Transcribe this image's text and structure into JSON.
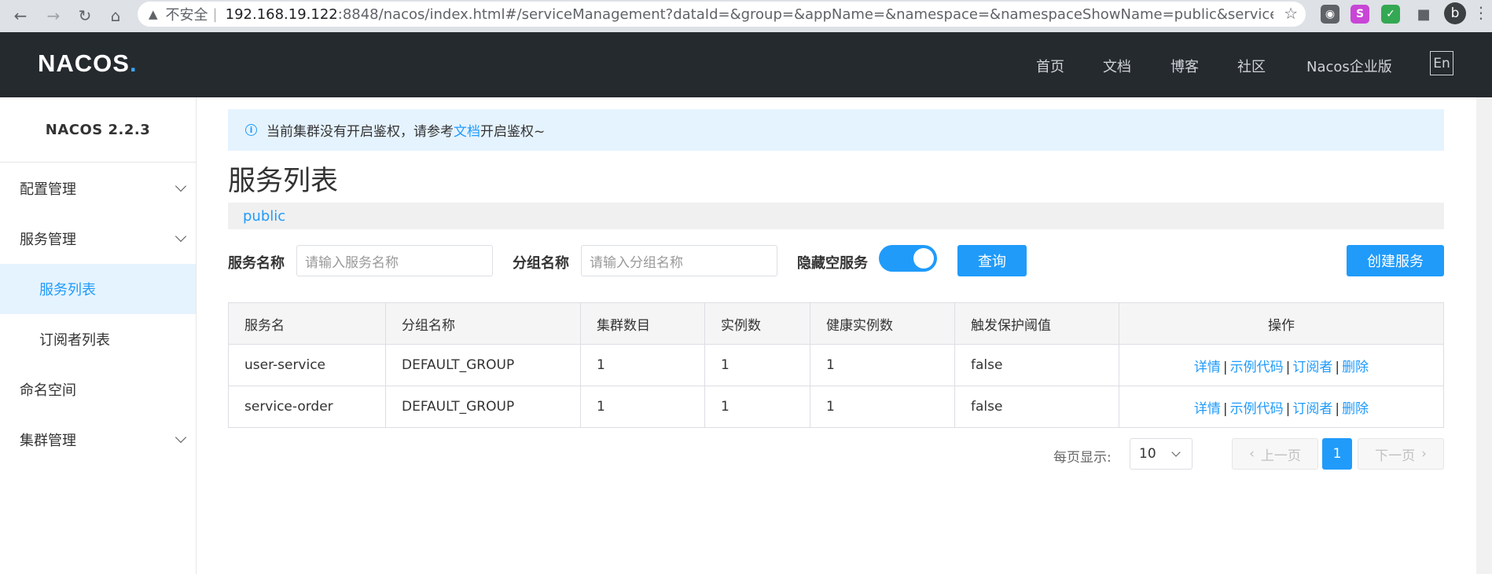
{
  "browser": {
    "warn_icon": "warning-triangle-icon",
    "insecure": "不安全",
    "separator": "|",
    "host": "192.168.19.122",
    "path": ":8848/nacos/index.html#/serviceManagement?dataId=&group=&appName=&namespace=&namespaceShowName=public&serviceNamePar...",
    "profile_initial": "b"
  },
  "header": {
    "logo_main": "NACOS",
    "logo_dot": ".",
    "nav": [
      "首页",
      "文档",
      "博客",
      "社区",
      "Nacos企业版"
    ],
    "lang": "En"
  },
  "sidebar": {
    "version": "NACOS 2.2.3",
    "items": [
      {
        "label": "配置管理"
      },
      {
        "label": "服务管理"
      },
      {
        "label": "服务列表"
      },
      {
        "label": "订阅者列表"
      },
      {
        "label": "命名空间"
      },
      {
        "label": "集群管理"
      }
    ]
  },
  "notice": {
    "prefix": "当前集群没有开启鉴权，请参考",
    "link": "文档",
    "suffix": "开启鉴权~"
  },
  "page": {
    "title": "服务列表",
    "namespace": "public"
  },
  "filters": {
    "service_name_label": "服务名称",
    "service_name_placeholder": "请输入服务名称",
    "group_name_label": "分组名称",
    "group_name_placeholder": "请输入分组名称",
    "hide_empty_label": "隐藏空服务",
    "hide_empty_on": true,
    "query_button": "查询",
    "create_button": "创建服务"
  },
  "table": {
    "headers": [
      "服务名",
      "分组名称",
      "集群数目",
      "实例数",
      "健康实例数",
      "触发保护阈值",
      "操作"
    ],
    "rows": [
      {
        "name": "user-service",
        "group": "DEFAULT_GROUP",
        "clusters": "1",
        "instances": "1",
        "healthy": "1",
        "protect": "false"
      },
      {
        "name": "service-order",
        "group": "DEFAULT_GROUP",
        "clusters": "1",
        "instances": "1",
        "healthy": "1",
        "protect": "false"
      }
    ],
    "actions": {
      "detail": "详情",
      "sample": "示例代码",
      "subscribers": "订阅者",
      "delete": "删除",
      "separator": "|"
    }
  },
  "pagination": {
    "page_size_label": "每页显示:",
    "page_size": "10",
    "prev": "上一页",
    "current": "1",
    "next": "下一页"
  },
  "colors": {
    "accent": "#209bfa",
    "header_bg": "#252a2f",
    "active_bg": "#e5f3ff"
  }
}
